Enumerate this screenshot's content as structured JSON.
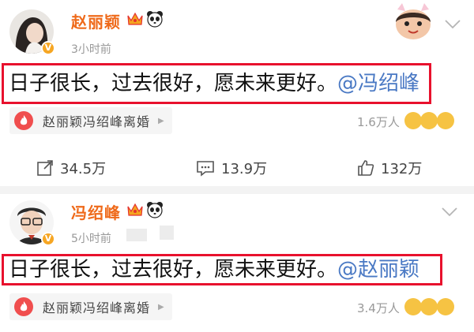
{
  "posts": [
    {
      "author": "赵丽颖",
      "time": "3小时前",
      "content_text": "日子很长，过去很好，愿未来更好。",
      "mention": "@冯绍峰",
      "topic": "赵丽颖冯绍峰离婚",
      "reaction_count": "1.6万人",
      "actions": {
        "repost": "34.5万",
        "comment": "13.9万",
        "like": "132万"
      }
    },
    {
      "author": "冯绍峰",
      "time": "5小时前",
      "content_text": "日子很长，过去很好，愿未来更好。",
      "mention": "@赵丽颖",
      "topic": "赵丽颖冯绍峰离婚",
      "reaction_count": "3.4万人"
    }
  ],
  "colors": {
    "name": "#ef6a1a",
    "mention": "#4a79c4",
    "highlight_border": "#e8112d",
    "badge": "#f6a623"
  },
  "icons": [
    "crown-icon",
    "panda-icon",
    "verified-icon",
    "chevron-down-icon",
    "fire-icon",
    "repost-icon",
    "comment-icon",
    "like-icon"
  ]
}
